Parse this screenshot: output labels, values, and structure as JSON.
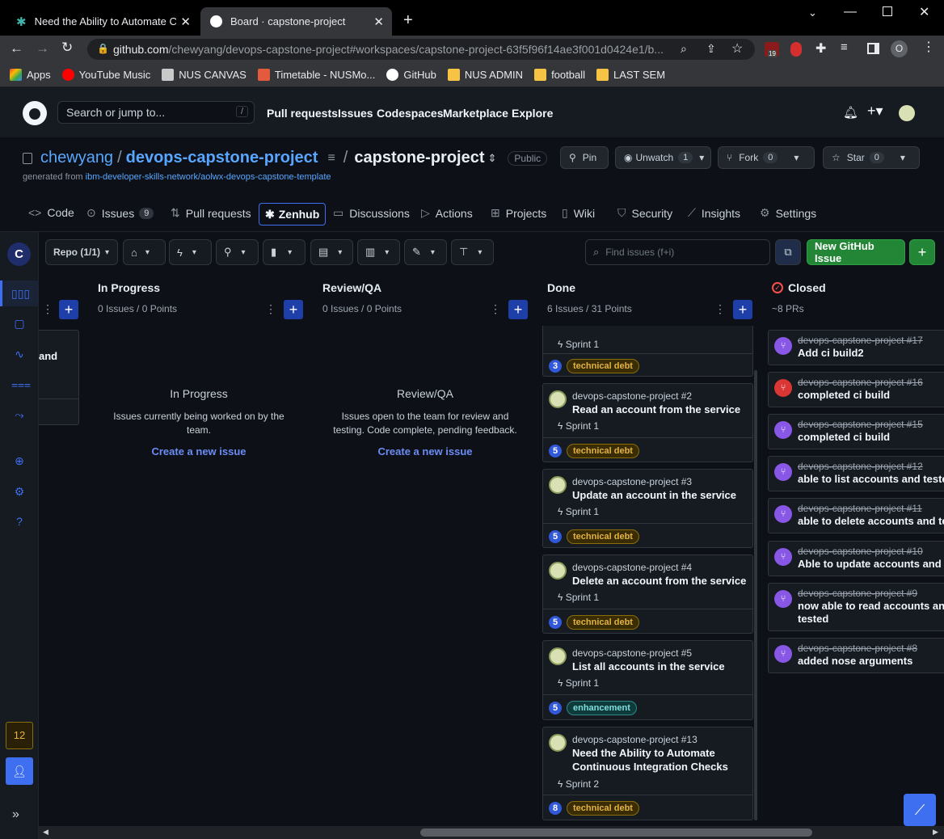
{
  "browser": {
    "tabs": [
      {
        "title": "Need the Ability to Automate Co",
        "active": false
      },
      {
        "title": "Board · capstone-project",
        "active": true
      }
    ],
    "url_host": "github.com",
    "url_path": "/chewyang/devops-capstone-project#workspaces/capstone-project-63f5f96f14ae3f001d0424e1/b...",
    "ext_badge": "19",
    "profile_initial": "O",
    "bookmarks": [
      "Apps",
      "YouTube Music",
      "NUS CANVAS",
      "Timetable - NUSMo...",
      "GitHub",
      "NUS ADMIN",
      "football",
      "LAST SEM"
    ]
  },
  "github": {
    "search_placeholder": "Search or jump to...",
    "search_key": "/",
    "nav": [
      "Pull requests",
      "Issues",
      "Codespaces",
      "Marketplace",
      "Explore"
    ]
  },
  "repo": {
    "owner": "chewyang",
    "name": "devops-capstone-project",
    "workspace": "capstone-project",
    "visibility": "Public",
    "generated_prefix": "generated from ",
    "generated_from": "ibm-developer-skills-network/aolwx-devops-capstone-template",
    "pin": "Pin",
    "unwatch": "Unwatch",
    "unwatch_count": "1",
    "fork": "Fork",
    "fork_count": "0",
    "star": "Star",
    "star_count": "0",
    "tabs": [
      {
        "label": "Code",
        "count": ""
      },
      {
        "label": "Issues",
        "count": "9"
      },
      {
        "label": "Pull requests",
        "count": ""
      },
      {
        "label": "Zenhub",
        "count": ""
      },
      {
        "label": "Discussions",
        "count": ""
      },
      {
        "label": "Actions",
        "count": ""
      },
      {
        "label": "Projects",
        "count": ""
      },
      {
        "label": "Wiki",
        "count": ""
      },
      {
        "label": "Security",
        "count": ""
      },
      {
        "label": "Insights",
        "count": ""
      },
      {
        "label": "Settings",
        "count": ""
      }
    ]
  },
  "zenhub": {
    "workspace_initial": "C",
    "repo_filter": "Repo (1/1)",
    "find_placeholder": "Find issues (f+i)",
    "new_issue": "New GitHub Issue",
    "notifications_count": "12",
    "partial_card_text": "and",
    "columns": {
      "in_progress": {
        "title": "In Progress",
        "summary": "0 Issues / 0 Points",
        "empty_title": "In Progress",
        "empty_desc": "Issues currently being worked on by the team.",
        "create": "Create a new issue"
      },
      "review": {
        "title": "Review/QA",
        "summary": "0 Issues / 0 Points",
        "empty_title": "Review/QA",
        "empty_desc": "Issues open to the team for review and testing. Code complete, pending feedback.",
        "create": "Create a new issue"
      },
      "done": {
        "title": "Done",
        "summary": "6 Issues / 31 Points"
      },
      "closed": {
        "title": "Closed",
        "summary": "~8 PRs"
      }
    },
    "done_cards": [
      {
        "repo": "",
        "title": "",
        "sprint": "Sprint 1",
        "estimate": "3",
        "label": "technical debt"
      },
      {
        "repo": "devops-capstone-project #2",
        "title": "Read an account from the service",
        "sprint": "Sprint 1",
        "estimate": "5",
        "label": "technical debt"
      },
      {
        "repo": "devops-capstone-project #3",
        "title": "Update an account in the service",
        "sprint": "Sprint 1",
        "estimate": "5",
        "label": "technical debt"
      },
      {
        "repo": "devops-capstone-project #4",
        "title": "Delete an account from the service",
        "sprint": "Sprint 1",
        "estimate": "5",
        "label": "technical debt"
      },
      {
        "repo": "devops-capstone-project #5",
        "title": "List all accounts in the service",
        "sprint": "Sprint 1",
        "estimate": "5",
        "label": "enhancement"
      },
      {
        "repo": "devops-capstone-project #13",
        "title": "Need the Ability to Automate Continuous Integration Checks",
        "sprint": "Sprint 2",
        "estimate": "8",
        "label": "technical debt"
      }
    ],
    "closed_prs": [
      {
        "repo": "devops-capstone-project #17",
        "title": "Add ci build2"
      },
      {
        "repo": "devops-capstone-project #16",
        "title": "completed ci build"
      },
      {
        "repo": "devops-capstone-project #15",
        "title": "completed ci build"
      },
      {
        "repo": "devops-capstone-project #12",
        "title": "able to list accounts and tested"
      },
      {
        "repo": "devops-capstone-project #11",
        "title": "able to delete accounts and tes"
      },
      {
        "repo": "devops-capstone-project #10",
        "title": "Able to update accounts and te"
      },
      {
        "repo": "devops-capstone-project #9",
        "title": "now able to read accounts and tested"
      },
      {
        "repo": "devops-capstone-project #8",
        "title": "added nose arguments"
      }
    ]
  }
}
